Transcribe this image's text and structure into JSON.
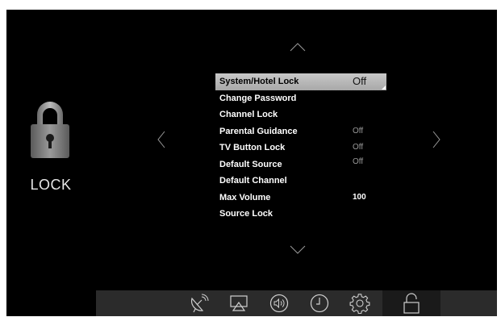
{
  "category": {
    "icon": "padlock-closed-icon",
    "label": "LOCK"
  },
  "navigation": {
    "up": "chevron-up-icon",
    "down": "chevron-down-icon",
    "left": "chevron-left-icon",
    "right": "chevron-right-icon"
  },
  "menu": {
    "items": [
      {
        "label": "System/Hotel Lock",
        "value": "Off",
        "selected": true
      },
      {
        "label": "Change Password",
        "value": ""
      },
      {
        "label": "Channel Lock",
        "value": ""
      },
      {
        "label": "Parental Guidance",
        "value": "Off"
      },
      {
        "label": "TV Button Lock",
        "value": "Off"
      },
      {
        "label": "Default Source",
        "value": "Off"
      },
      {
        "label": "Default Channel",
        "value": ""
      },
      {
        "label": "Max Volume",
        "value": "100"
      },
      {
        "label": "Source Lock",
        "value": ""
      }
    ]
  },
  "bottom_bar": {
    "tabs": [
      {
        "icon": "satellite-dish-icon",
        "active": false
      },
      {
        "icon": "picture-display-icon",
        "active": false
      },
      {
        "icon": "sound-speaker-icon",
        "active": false
      },
      {
        "icon": "clock-icon",
        "active": false
      },
      {
        "icon": "gear-icon",
        "active": false
      },
      {
        "icon": "padlock-open-icon",
        "active": true
      }
    ]
  },
  "colors": {
    "background": "#000000",
    "highlight": "#b8b8b8",
    "text": "#ffffff",
    "muted_value": "#9a9a9a",
    "bar": "#2b2b2b"
  }
}
